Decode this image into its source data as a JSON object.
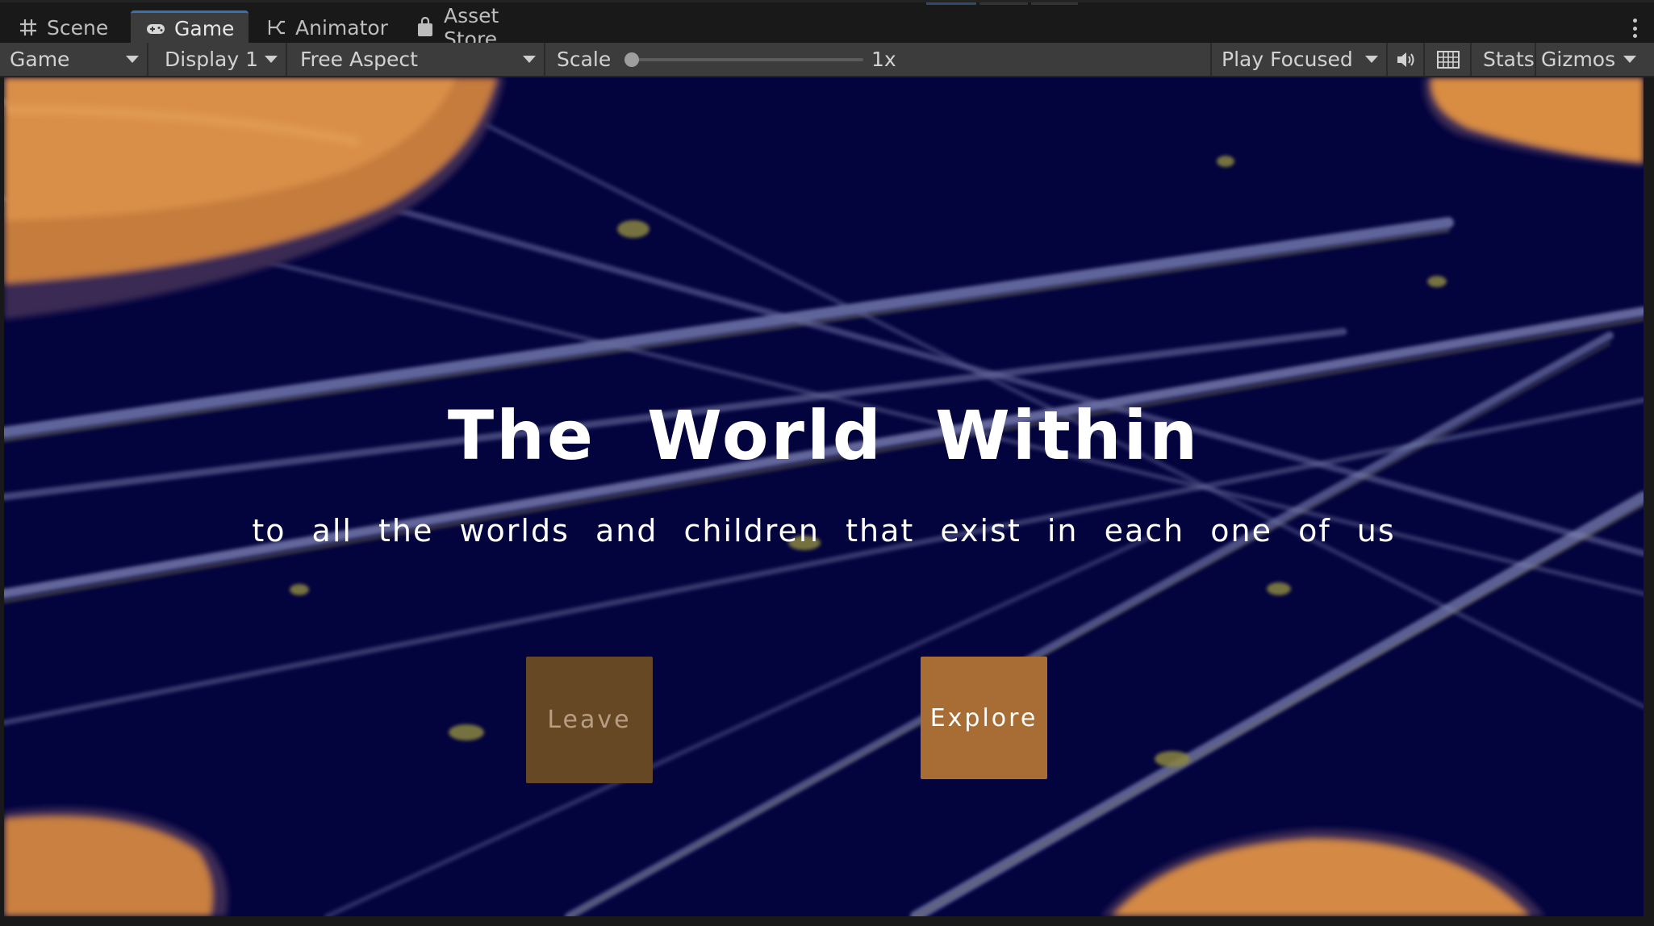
{
  "tabs": [
    {
      "label": "Scene",
      "icon": "hash-grid-icon",
      "active": false
    },
    {
      "label": "Game",
      "icon": "gamepad-icon",
      "active": true
    },
    {
      "label": "Animator",
      "icon": "animator-icon",
      "active": false
    },
    {
      "label": "Asset Store",
      "icon": "shopping-bag-icon",
      "active": false
    }
  ],
  "toolbar": {
    "view_mode": "Game",
    "display": "Display 1",
    "aspect": "Free Aspect",
    "scale_label": "Scale",
    "scale_value": "1x",
    "scale_fraction": 0,
    "play_mode": "Play Focused",
    "audio_icon": "speaker-icon",
    "stats_grid_icon": "grid-icon",
    "stats_label": "Stats",
    "gizmos_label": "Gizmos"
  },
  "game": {
    "title": "The World Within",
    "subtitle": "to all the worlds and children that exist in each one of us",
    "leave_label": "Leave",
    "explore_label": "Explore"
  },
  "colors": {
    "editor_bg": "#191919",
    "toolbar_bg": "#3c3c3c",
    "active_tab_accent": "#3a72b0",
    "game_bg": "#03033e",
    "planet_orange": "#d98d43",
    "leave_button": "#664825",
    "explore_button": "#a86d35"
  }
}
